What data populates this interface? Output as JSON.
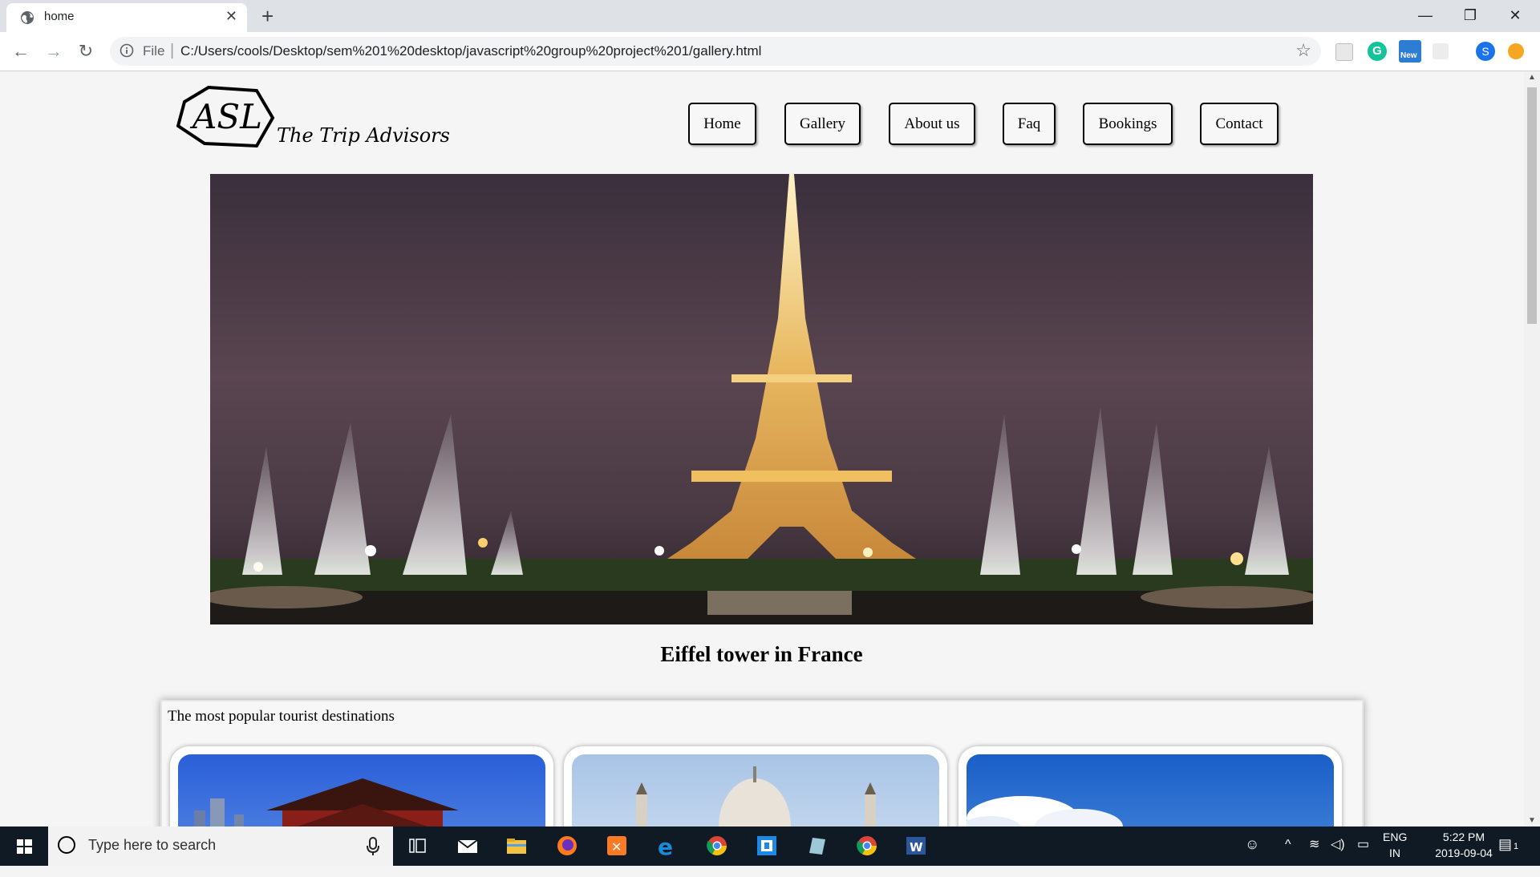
{
  "browser": {
    "tab_title": "home",
    "file_label": "File",
    "url": "C:/Users/cools/Desktop/sem%201%20desktop/javascript%20group%20project%201/gallery.html",
    "extensions": [
      "new-badge",
      "grammarly",
      "s-profile",
      "orange-alert"
    ],
    "ext_new_label": "New",
    "profile_letter": "S"
  },
  "site": {
    "logo_text": "ASL",
    "tagline": "The Trip Advisors",
    "nav": [
      "Home",
      "Gallery",
      "About us",
      "Faq",
      "Bookings",
      "Contact"
    ]
  },
  "hero": {
    "caption": "Eiffel tower in France"
  },
  "destinations": {
    "heading": "The most popular tourist destinations",
    "cards": [
      "pagoda-temple-photo",
      "taj-mahal-photo",
      "sky-clouds-photo"
    ]
  },
  "taskbar": {
    "search_placeholder": "Type here to search",
    "lang": "ENG",
    "region": "IN",
    "time": "5:22 PM",
    "date": "2019-09-04",
    "notification_count": "1"
  }
}
